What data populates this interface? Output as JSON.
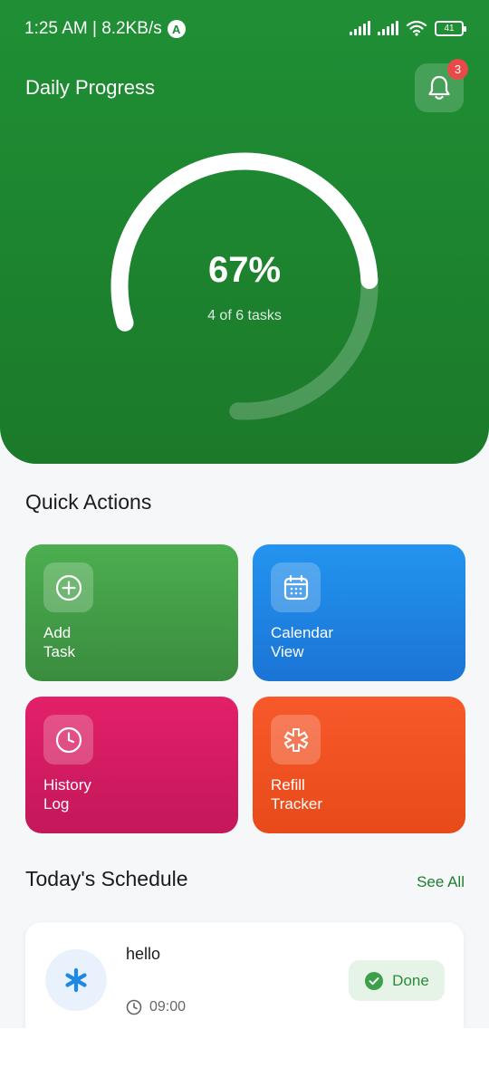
{
  "status_bar": {
    "time_speed": "1:25 AM | 8.2KB/s",
    "badge_letter": "A",
    "battery": "41"
  },
  "header": {
    "title": "Daily Progress",
    "notification_count": "3"
  },
  "progress": {
    "percent_label": "67%",
    "fraction": 0.67,
    "tasks_label": "4 of 6 tasks"
  },
  "quick_actions": {
    "title": "Quick Actions",
    "items": [
      {
        "label": "Add\nTask",
        "icon": "plus-circle-icon",
        "color": "#43a047"
      },
      {
        "label": "Calendar\nView",
        "icon": "calendar-icon",
        "color": "#1e88e5"
      },
      {
        "label": "History\nLog",
        "icon": "clock-icon",
        "color": "#d81b60"
      },
      {
        "label": "Refill\nTracker",
        "icon": "medical-star-icon",
        "color": "#f4511e"
      }
    ]
  },
  "schedule": {
    "title": "Today's Schedule",
    "see_all": "See All",
    "items": [
      {
        "name": "hello",
        "time": "09:00",
        "status": "Done",
        "icon": "asterisk-icon"
      }
    ]
  },
  "colors": {
    "primary_green": "#1f8f35",
    "accent_text_green": "#1f7d30",
    "badge_red": "#e84a4a"
  }
}
